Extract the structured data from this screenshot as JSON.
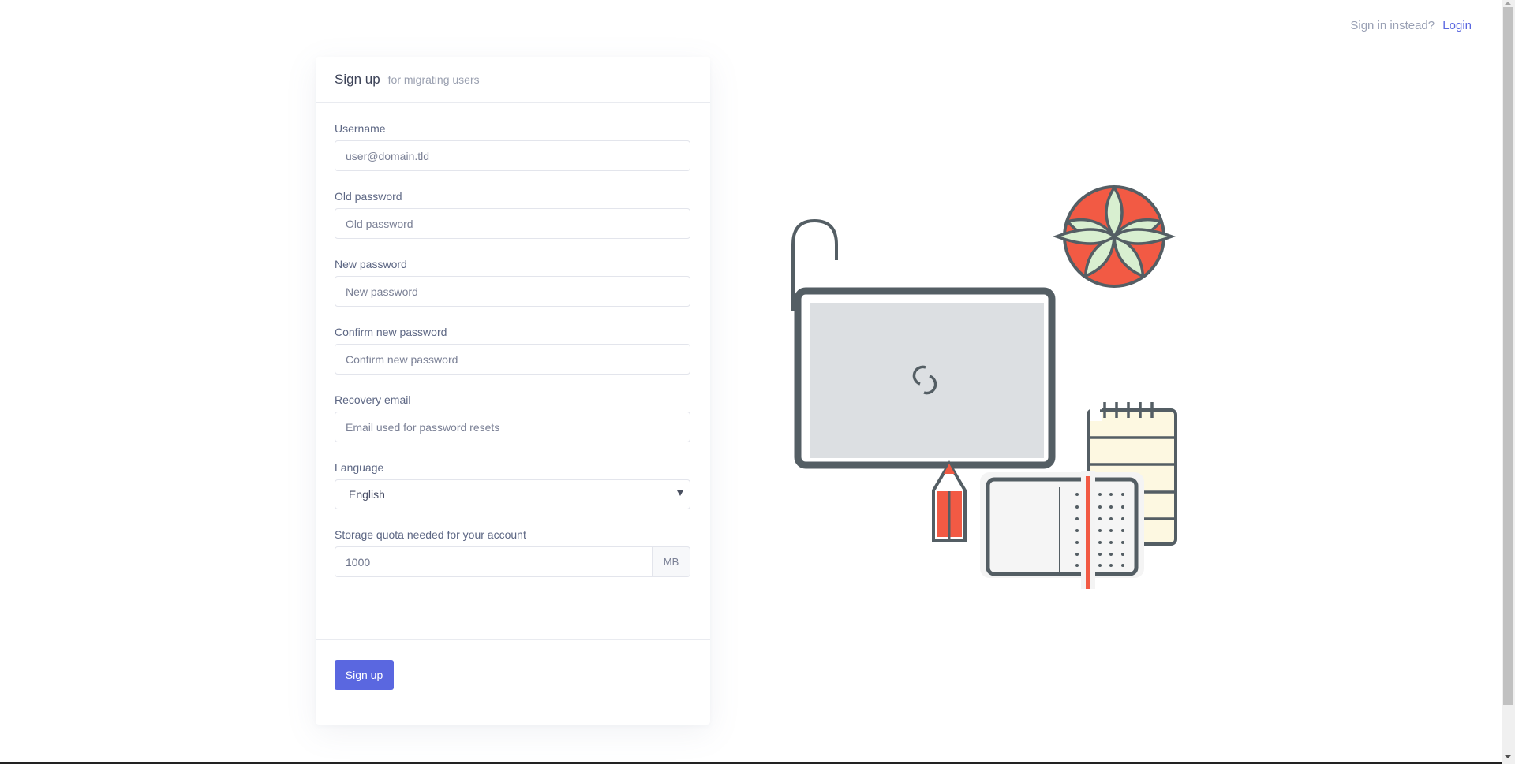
{
  "topbar": {
    "prompt": "Sign in instead?",
    "login_link": "Login"
  },
  "card": {
    "title": "Sign up",
    "subtitle": "for migrating users",
    "fields": {
      "username": {
        "label": "Username",
        "placeholder": "user@domain.tld",
        "value": ""
      },
      "old_password": {
        "label": "Old password",
        "placeholder": "Old password",
        "value": ""
      },
      "new_password": {
        "label": "New password",
        "placeholder": "New password",
        "value": ""
      },
      "confirm_password": {
        "label": "Confirm new password",
        "placeholder": "Confirm new password",
        "value": ""
      },
      "recovery_email": {
        "label": "Recovery email",
        "placeholder": "Email used for password resets",
        "value": ""
      },
      "language": {
        "label": "Language",
        "selected": "English"
      },
      "quota": {
        "label": "Storage quota needed for your account",
        "value": "1000",
        "unit": "MB"
      }
    },
    "submit_label": "Sign up"
  },
  "colors": {
    "accent": "#5a67e0",
    "illustration_outline": "#545e64",
    "illustration_red": "#f25a44",
    "illustration_leaf": "#d8efd0",
    "illustration_note": "#fdf8e1",
    "illustration_screen": "#dcdfe2"
  },
  "illustration": {
    "icons": [
      "laptop-icon",
      "plant-icon",
      "notepad-icon",
      "notebook-icon",
      "pencil-icon"
    ]
  }
}
